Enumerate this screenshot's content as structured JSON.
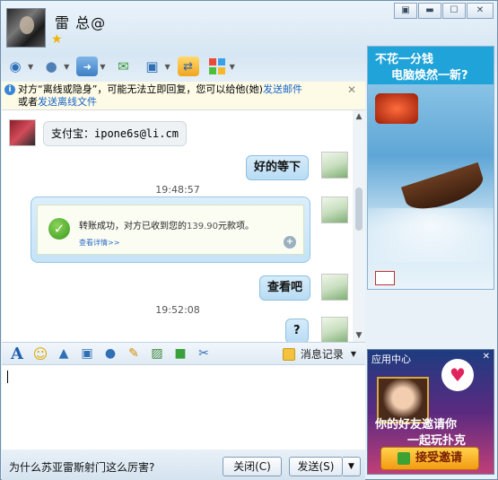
{
  "window": {
    "contact_name": "雷 总@",
    "buttons": {
      "skin": "▣",
      "minimize": "▬",
      "maximize": "☐",
      "close": "✕"
    }
  },
  "toolbar": {
    "items": [
      {
        "icon": "video-icon",
        "glyph": "◉"
      },
      {
        "icon": "microphone-icon",
        "glyph": "🎤"
      },
      {
        "icon": "file-transfer-icon",
        "glyph": "▭"
      },
      {
        "icon": "sms-icon",
        "glyph": "✉"
      },
      {
        "icon": "screen-share-icon",
        "glyph": "▣"
      },
      {
        "icon": "remote-assist-icon",
        "glyph": "⇄"
      },
      {
        "icon": "apps-icon",
        "glyph": "▦"
      }
    ]
  },
  "notice": {
    "text_before": "对方“离线或隐身”，可能无法立即回复，您可以给他(她)",
    "link_email": "发送邮件",
    "text_mid": "或者",
    "link_offline_file": "发送离线文件",
    "close": "✕"
  },
  "chat": {
    "messages": [
      {
        "from": "other",
        "text": "支付宝：ipone6s@li.cm"
      },
      {
        "from": "me",
        "text": "好的等下"
      },
      {
        "timestamp": "19:48:57"
      },
      {
        "from": "me",
        "card": {
          "title": "转账成功，对方已收到您的",
          "amount": "139.90",
          "suffix": "元款项。",
          "link": "查看详情>>"
        }
      },
      {
        "from": "me",
        "text": "查看吧"
      },
      {
        "timestamp": "19:52:08"
      },
      {
        "from": "me",
        "text": "?"
      }
    ]
  },
  "input_toolbar": {
    "font_label": "A",
    "history_label": "消息记录"
  },
  "bottom": {
    "draft_text": "为什么苏亚雷斯射门这么厉害?",
    "close_button": "关闭(C)",
    "send_button": "发送(S)"
  },
  "ads": {
    "top": {
      "line1": "不花一分钱",
      "line2": "电脑焕然一新?"
    },
    "bottom": {
      "label": "应用中心",
      "line1": "你的好友邀请你",
      "line2": "一起玩扑克",
      "button": "接受邀请"
    }
  }
}
